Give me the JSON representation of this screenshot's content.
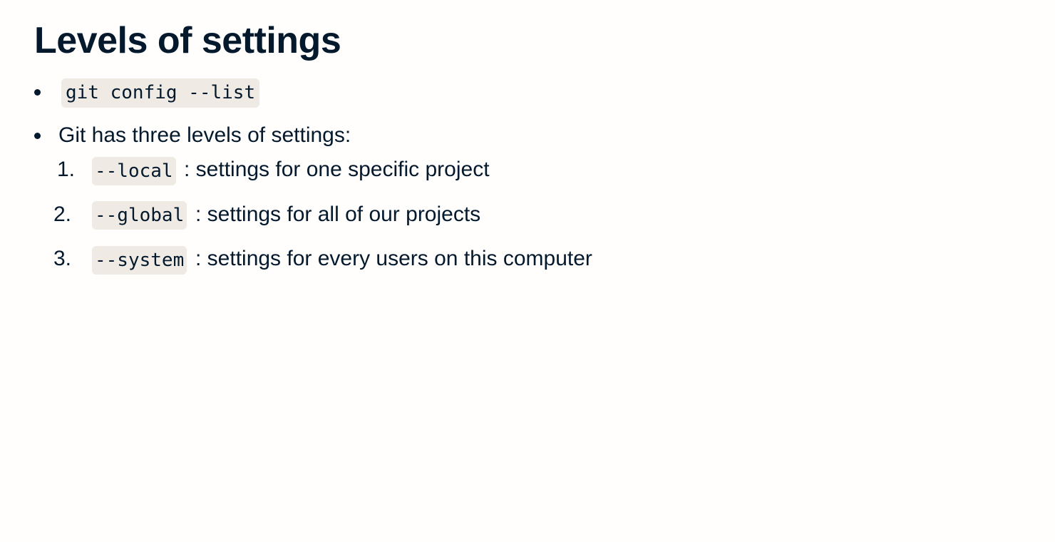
{
  "slide": {
    "title": "Levels of settings",
    "bullets": [
      {
        "code": "git config --list"
      },
      {
        "text": "Git has three levels of settings:",
        "levels": [
          {
            "number": "1.",
            "flag": "--local",
            "description": ": settings for one specific project"
          },
          {
            "number": "2.",
            "flag": "--global",
            "description": ": settings for all of our projects"
          },
          {
            "number": "3.",
            "flag": "--system",
            "description": ": settings for every users on this computer"
          }
        ]
      }
    ]
  }
}
